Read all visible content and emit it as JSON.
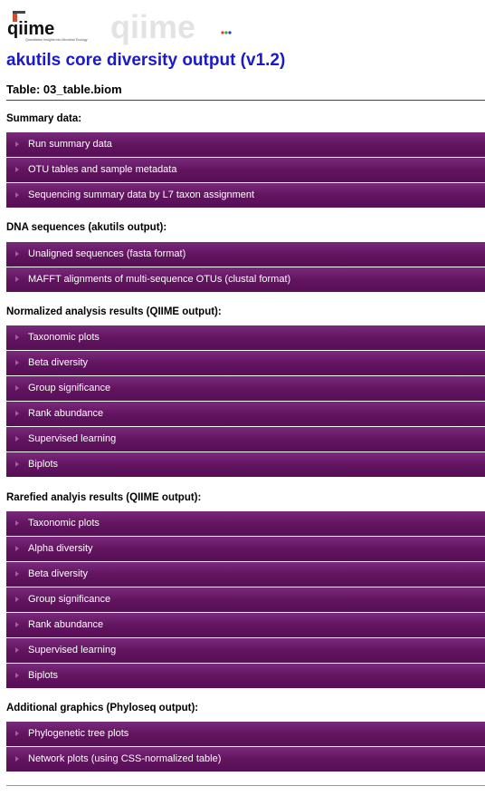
{
  "header": {
    "logo_left_text": "qiime",
    "logo_left_tagline": "Quantitative Insights into Microbial Ecology",
    "logo_right_text": "qiime",
    "page_title": "akutils core diversity output (v1.2)",
    "table_label": "Table: 03_table.biom"
  },
  "colors": {
    "title_blue": "#1a1acc",
    "menu_purple": "#62145f",
    "bullet": "#a85aa6"
  },
  "sections": [
    {
      "title": "Summary data:",
      "items": [
        "Run summary data",
        "OTU tables and sample metadata",
        "Sequencing summary data by L7 taxon assignment"
      ]
    },
    {
      "title": "DNA sequences (akutils output):",
      "items": [
        "Unaligned sequences (fasta format)",
        "MAFFT alignments of multi-sequence OTUs (clustal format)"
      ]
    },
    {
      "title": "Normalized analysis results (QIIME output):",
      "items": [
        "Taxonomic plots",
        "Beta diversity",
        "Group significance",
        "Rank abundance",
        "Supervised learning",
        "Biplots"
      ]
    },
    {
      "title": "Rarefied analyis results (QIIME output):",
      "items": [
        "Taxonomic plots",
        "Alpha diversity",
        "Beta diversity",
        "Group significance",
        "Rank abundance",
        "Supervised learning",
        "Biplots"
      ]
    },
    {
      "title": "Additional graphics (Phyloseq output):",
      "items": [
        "Phylogenetic tree plots",
        "Network plots (using CSS-normalized table)"
      ]
    }
  ]
}
